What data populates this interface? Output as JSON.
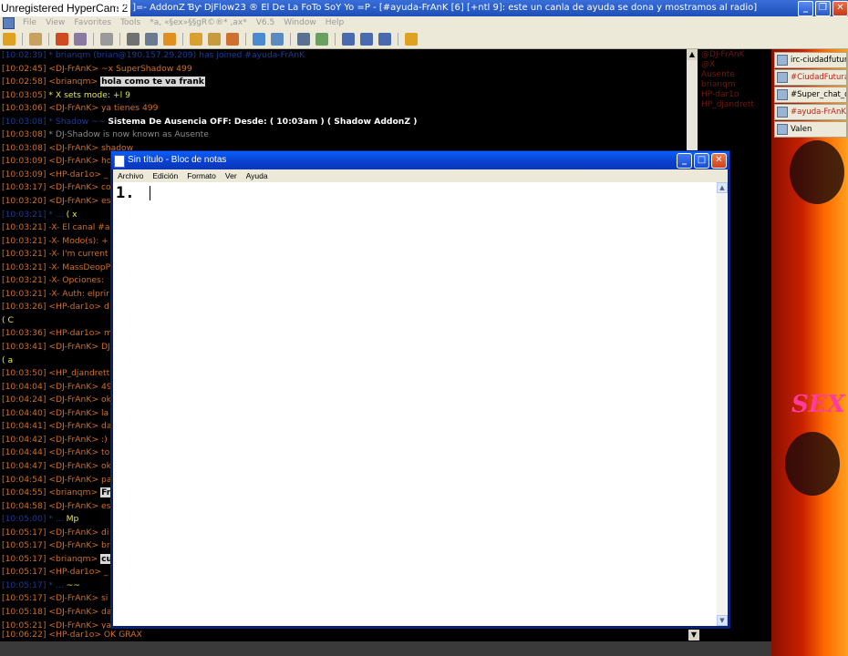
{
  "mirc": {
    "overlay_label": "Unregistered HyperCam 2",
    "title": "6.5 ]=- AddonZ Ɓƴ DjFlow23 ® El De La FoTo SoY Yo =P - [#ayuda-FrAnK [6] [+ntl 9]: este un canla de ayuda se dona y mostramos al radio]",
    "menu": [
      "File",
      "View",
      "Favorites",
      "Tools",
      "*a, «§ex»§§gR©®* ,ax*",
      "V6.5",
      "Window",
      "Help"
    ],
    "input_value": "[10:06:22] <HP-dar1o> OK GRAX"
  },
  "chat_lines": [
    {
      "ts": "[10:02:39]",
      "nick": "* brianqm (brian@190.157.29.209) has joined #ayuda-FrAnK",
      "cls": "dim"
    },
    {
      "ts": "[10:02:45]",
      "nick": "<DJ-FrAnK>",
      "msg": "~x SuperShadow 499"
    },
    {
      "ts": "[10:02:58]",
      "nick": "<brianqm>",
      "msg": "hola como te va frank",
      "cls": "hl"
    },
    {
      "ts": "[10:03:05]",
      "nick": "* X sets mode: +l 9",
      "cls": "yel"
    },
    {
      "ts": "[10:03:06]",
      "nick": "<DJ-FrAnK>",
      "msg": "ya tienes 499"
    },
    {
      "ts": "[10:03:08]",
      "nick": "* Shadow ~~",
      "extra": "Sistema De Ausencia OFF: Desde: ( 10:03am ) ( Shadow AddonZ )",
      "cls": "dim"
    },
    {
      "ts": "[10:03:08]",
      "nick": "* DJ-Shadow is now known as Ausente",
      "cls": "grey"
    },
    {
      "ts": "[10:03:08]",
      "nick": "<DJ-FrAnK>",
      "msg": "shadow"
    },
    {
      "ts": "[10:03:09]",
      "nick": "<DJ-FrAnK>",
      "msg": "ho"
    },
    {
      "ts": "[10:03:09]",
      "nick": "<HP-dar1o>",
      "msg": "_"
    },
    {
      "ts": "[10:03:17]",
      "nick": "<DJ-FrAnK>",
      "msg": "co"
    },
    {
      "ts": "[10:03:20]",
      "nick": "<DJ-FrAnK>",
      "msg": "es"
    },
    {
      "ts": "[10:03:21]",
      "nick": "* ...",
      "msg": "( x",
      "cls": "dim"
    },
    {
      "ts": "[10:03:21]",
      "nick": "-X- El canal #a",
      "cls": "white2"
    },
    {
      "ts": "[10:03:21]",
      "nick": "-X- Modo(s): +",
      "cls": "white2"
    },
    {
      "ts": "[10:03:21]",
      "nick": "-X- I'm current",
      "cls": "white2"
    },
    {
      "ts": "[10:03:21]",
      "nick": "-X- MassDeopP",
      "cls": "white2"
    },
    {
      "ts": "[10:03:21]",
      "nick": "-X- Opciones:",
      "cls": "white2"
    },
    {
      "ts": "[10:03:21]",
      "nick": "-X- Auth: elprir",
      "cls": "white2"
    },
    {
      "ts": "[10:03:26]",
      "nick": "<HP-dar1o>",
      "msg": "d"
    },
    {
      "ts": "",
      "nick": "",
      "msg": "( C",
      "cls": "dim"
    },
    {
      "ts": "[10:03:36]",
      "nick": "<HP-dar1o>",
      "msg": "m"
    },
    {
      "ts": "[10:03:41]",
      "nick": "<DJ-FrAnK>",
      "msg": "DJ"
    },
    {
      "ts": "",
      "nick": "",
      "msg": "( a",
      "cls": "dim"
    },
    {
      "ts": "[10:03:50]",
      "nick": "<HP_djandrett",
      "msg": ""
    },
    {
      "ts": "[10:04:04]",
      "nick": "<DJ-FrAnK>",
      "msg": "49"
    },
    {
      "ts": "[10:04:24]",
      "nick": "<DJ-FrAnK>",
      "msg": "ok"
    },
    {
      "ts": "[10:04:40]",
      "nick": "<DJ-FrAnK>",
      "msg": "la"
    },
    {
      "ts": "[10:04:41]",
      "nick": "<DJ-FrAnK>",
      "msg": "da"
    },
    {
      "ts": "[10:04:42]",
      "nick": "<DJ-FrAnK>",
      "msg": ":)"
    },
    {
      "ts": "[10:04:44]",
      "nick": "<DJ-FrAnK>",
      "msg": "to"
    },
    {
      "ts": "[10:04:47]",
      "nick": "<DJ-FrAnK>",
      "msg": "ok"
    },
    {
      "ts": "[10:04:54]",
      "nick": "<DJ-FrAnK>",
      "msg": "pa"
    },
    {
      "ts": "[10:04:55]",
      "nick": "<brianqm>",
      "msg": "Fr",
      "cls": "hl2"
    },
    {
      "ts": "[10:04:58]",
      "nick": "<DJ-FrAnK>",
      "msg": "es"
    },
    {
      "ts": "[10:05:00]",
      "nick": "* ...",
      "msg": "Mp",
      "cls": "dim"
    },
    {
      "ts": "[10:05:17]",
      "nick": "<DJ-FrAnK>",
      "msg": "di"
    },
    {
      "ts": "[10:05:17]",
      "nick": "<DJ-FrAnK>",
      "msg": "br"
    },
    {
      "ts": "[10:05:17]",
      "nick": "<brianqm>",
      "msg": "cu",
      "cls": "hl2"
    },
    {
      "ts": "[10:05:17]",
      "nick": "<HP-dar1o>",
      "msg": "_"
    },
    {
      "ts": "[10:05:17]",
      "nick": "* ...",
      "msg": "~~",
      "cls": "dim"
    },
    {
      "ts": "[10:05:17]",
      "nick": "<DJ-FrAnK>",
      "msg": "si"
    },
    {
      "ts": "[10:05:18]",
      "nick": "<DJ-FrAnK>",
      "msg": "da"
    },
    {
      "ts": "[10:05:21]",
      "nick": "<DJ-FrAnK>",
      "msg": "ya"
    }
  ],
  "nicklist": [
    "@DJ-FrAnK",
    "@X",
    "Ausente",
    "brianqm",
    "HP-dar1o",
    "HP_djandrett"
  ],
  "switchbar": [
    {
      "label": "irc-ciudadfutura...",
      "red": false
    },
    {
      "label": "#CiudadFutura",
      "red": true
    },
    {
      "label": "#Super_chat_d...",
      "red": false
    },
    {
      "label": "#ayuda-FrAnK",
      "red": true
    },
    {
      "label": "Valen",
      "red": false
    }
  ],
  "notepad": {
    "title": "Sin título - Bloc de notas",
    "menu": [
      "Archivo",
      "Edición",
      "Formato",
      "Ver",
      "Ayuda"
    ],
    "text": "1."
  },
  "colors": {
    "accent": "#0a5ff8",
    "chat_text": "#d07020",
    "highlight_bg": "#d8d8d8"
  }
}
